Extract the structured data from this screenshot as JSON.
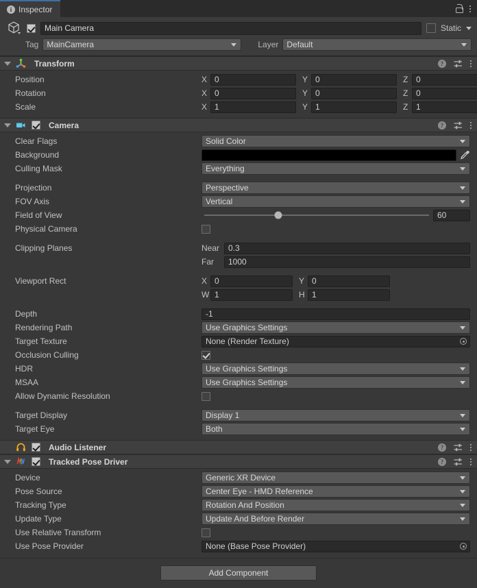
{
  "tab": {
    "label": "Inspector",
    "info_icon": "info-circle-icon",
    "lock_icon": "lock-icon",
    "menu_icon": "kebab-menu-icon"
  },
  "gameobject": {
    "icon": "cube-icon",
    "enabled": true,
    "name": "Main Camera",
    "static_label": "Static",
    "static_checked": false,
    "tag_label": "Tag",
    "tag_value": "MainCamera",
    "layer_label": "Layer",
    "layer_value": "Default"
  },
  "components": [
    {
      "id": "transform",
      "title": "Transform",
      "icon": "transform-axis-icon",
      "expanded": true,
      "has_checkbox": false,
      "help_icon": "help-icon",
      "preset_icon": "preset-sliders-icon",
      "menu_icon": "kebab-menu-icon",
      "rows": [
        {
          "type": "vector3",
          "label": "Position",
          "axes": [
            "X",
            "Y",
            "Z"
          ],
          "values": [
            "0",
            "0",
            "0"
          ]
        },
        {
          "type": "vector3",
          "label": "Rotation",
          "axes": [
            "X",
            "Y",
            "Z"
          ],
          "values": [
            "0",
            "0",
            "0"
          ]
        },
        {
          "type": "vector3",
          "label": "Scale",
          "axes": [
            "X",
            "Y",
            "Z"
          ],
          "values": [
            "1",
            "1",
            "1"
          ]
        }
      ]
    },
    {
      "id": "camera",
      "title": "Camera",
      "icon": "camera-icon",
      "expanded": true,
      "has_checkbox": true,
      "checked": true,
      "help_icon": "help-icon",
      "preset_icon": "preset-sliders-icon",
      "menu_icon": "kebab-menu-icon",
      "rows": [
        {
          "type": "dropdown",
          "label": "Clear Flags",
          "value": "Solid Color"
        },
        {
          "type": "color",
          "label": "Background",
          "value": "#000000",
          "eyedropper": "eyedropper-icon"
        },
        {
          "type": "dropdown",
          "label": "Culling Mask",
          "value": "Everything"
        },
        {
          "type": "spacer"
        },
        {
          "type": "dropdown",
          "label": "Projection",
          "value": "Perspective"
        },
        {
          "type": "dropdown",
          "label": "FOV Axis",
          "value": "Vertical"
        },
        {
          "type": "slider",
          "label": "Field of View",
          "value": "60",
          "min": 1,
          "max": 179,
          "percent": 33
        },
        {
          "type": "checkbox",
          "label": "Physical Camera",
          "checked": false
        },
        {
          "type": "spacer"
        },
        {
          "type": "pair",
          "label": "Clipping Planes",
          "sub_label_1": "Near",
          "value_1": "0.3"
        },
        {
          "type": "pair-cont",
          "label": "",
          "sub_label_1": "Far",
          "value_1": "1000"
        },
        {
          "type": "spacer"
        },
        {
          "type": "vector2",
          "label": "Viewport Rect",
          "axes": [
            "X",
            "Y"
          ],
          "values": [
            "0",
            "0"
          ]
        },
        {
          "type": "vector2-cont",
          "label": "",
          "axes": [
            "W",
            "H"
          ],
          "values": [
            "1",
            "1"
          ]
        },
        {
          "type": "spacer"
        },
        {
          "type": "text",
          "label": "Depth",
          "value": "-1"
        },
        {
          "type": "dropdown",
          "label": "Rendering Path",
          "value": "Use Graphics Settings"
        },
        {
          "type": "object",
          "label": "Target Texture",
          "value": "None (Render Texture)"
        },
        {
          "type": "checkbox",
          "label": "Occlusion Culling",
          "checked": true
        },
        {
          "type": "dropdown",
          "label": "HDR",
          "value": "Use Graphics Settings"
        },
        {
          "type": "dropdown",
          "label": "MSAA",
          "value": "Use Graphics Settings"
        },
        {
          "type": "checkbox",
          "label": "Allow Dynamic Resolution",
          "checked": false
        },
        {
          "type": "spacer"
        },
        {
          "type": "dropdown",
          "label": "Target Display",
          "value": "Display 1"
        },
        {
          "type": "dropdown",
          "label": "Target Eye",
          "value": "Both"
        }
      ]
    },
    {
      "id": "audio-listener",
      "title": "Audio Listener",
      "icon": "headphones-icon",
      "expanded": false,
      "has_checkbox": true,
      "checked": true,
      "help_icon": "help-icon",
      "preset_icon": "preset-sliders-icon",
      "menu_icon": "kebab-menu-icon",
      "rows": []
    },
    {
      "id": "tracked-pose-driver",
      "title": "Tracked Pose Driver",
      "icon": "script-xr-icon",
      "expanded": true,
      "has_checkbox": true,
      "checked": true,
      "help_icon": "help-icon",
      "preset_icon": "preset-sliders-icon",
      "menu_icon": "kebab-menu-icon",
      "rows": [
        {
          "type": "dropdown",
          "label": "Device",
          "value": "Generic XR Device"
        },
        {
          "type": "dropdown",
          "label": "Pose Source",
          "value": "Center Eye - HMD Reference"
        },
        {
          "type": "dropdown",
          "label": "Tracking Type",
          "value": "Rotation And Position"
        },
        {
          "type": "dropdown",
          "label": "Update Type",
          "value": "Update And Before Render"
        },
        {
          "type": "checkbox",
          "label": "Use Relative Transform",
          "checked": false
        },
        {
          "type": "object",
          "label": "Use Pose Provider",
          "value": "None (Base Pose Provider)"
        }
      ]
    }
  ],
  "footer": {
    "add_component_label": "Add Component"
  },
  "colors": {
    "accent_tab": "#3f6fa8",
    "panel_bg": "#383838",
    "header_bg": "#3c3c3c",
    "field_bg": "#2a2a2a",
    "dropdown_bg": "#585858",
    "background_color_value": "#000000"
  }
}
